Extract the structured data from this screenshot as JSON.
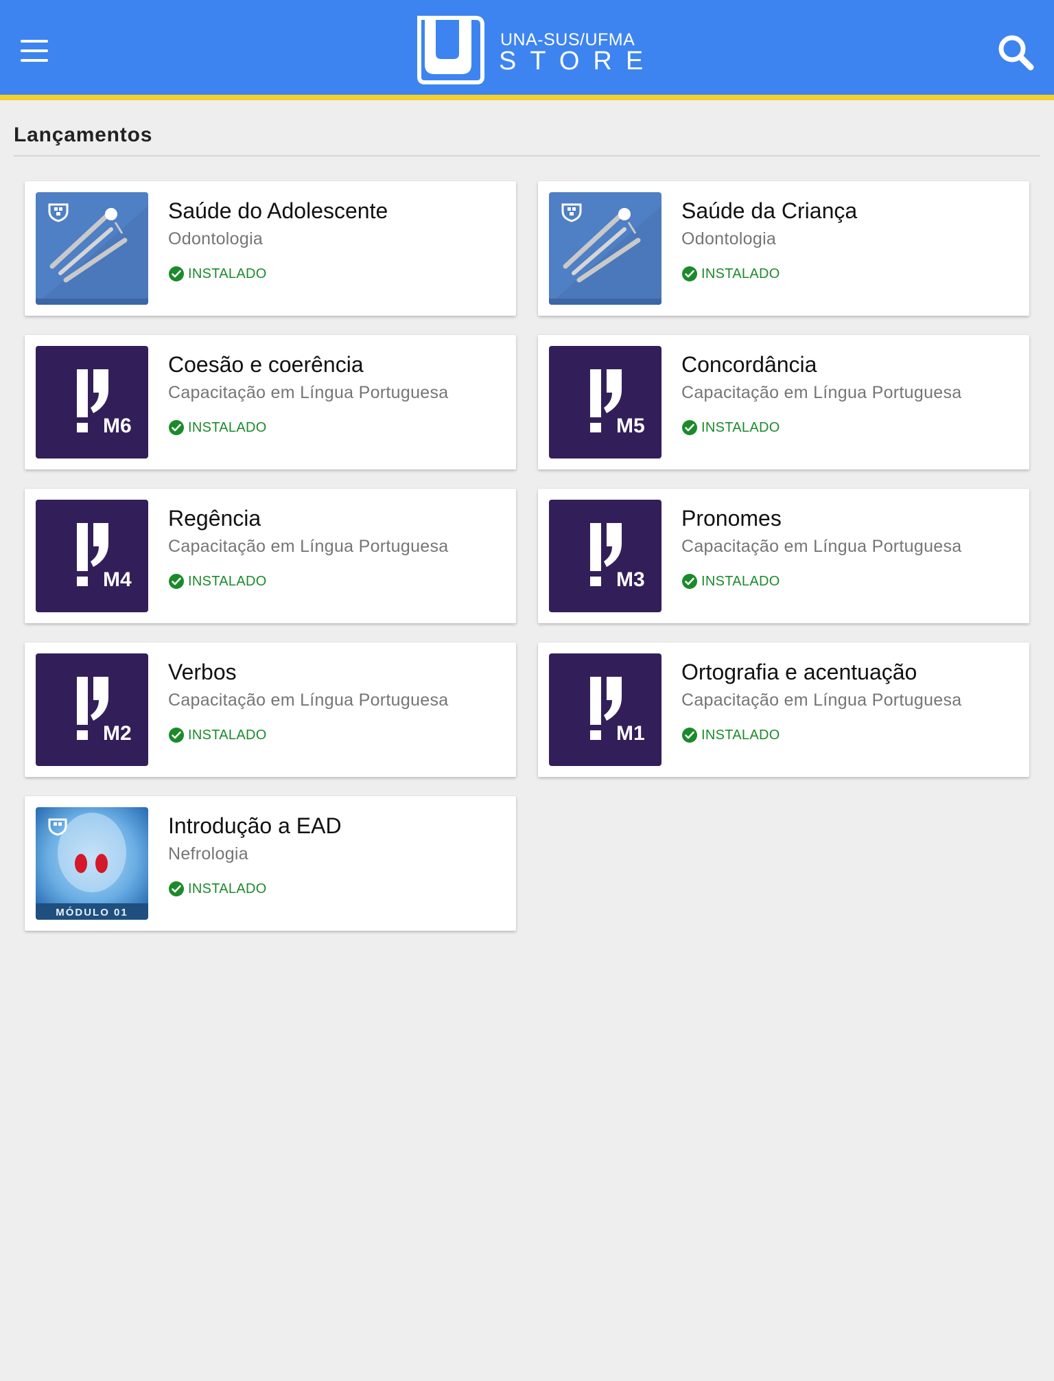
{
  "app_bar": {
    "logo_line1": "UNA-SUS/UFMA",
    "logo_line2": "STORE",
    "menu_icon": "hamburger-menu-icon",
    "search_icon": "search-icon",
    "colors": {
      "primary": "#3d84f0",
      "accent": "#f3d02e"
    }
  },
  "section": {
    "title": "Lançamentos"
  },
  "status_color": "#1b8a2a",
  "apps": [
    {
      "title": "Saúde do Adolescente",
      "subtitle": "Odontologia",
      "status": "INSTALADO",
      "icon": "dental-tools-icon"
    },
    {
      "title": "Saúde da Criança",
      "subtitle": "Odontologia",
      "status": "INSTALADO",
      "icon": "dental-tools-icon"
    },
    {
      "title": "Coesão e coerência",
      "subtitle": "Capacitação em Língua Portuguesa",
      "status": "INSTALADO",
      "icon": "module-icon",
      "module": "M6"
    },
    {
      "title": "Concordância",
      "subtitle": "Capacitação em Língua Portuguesa",
      "status": "INSTALADO",
      "icon": "module-icon",
      "module": "M5"
    },
    {
      "title": "Regência",
      "subtitle": "Capacitação em Língua Portuguesa",
      "status": "INSTALADO",
      "icon": "module-icon",
      "module": "M4"
    },
    {
      "title": "Pronomes",
      "subtitle": "Capacitação em Língua Portuguesa",
      "status": "INSTALADO",
      "icon": "module-icon",
      "module": "M3"
    },
    {
      "title": "Verbos",
      "subtitle": "Capacitação em Língua Portuguesa",
      "status": "INSTALADO",
      "icon": "module-icon",
      "module": "M2"
    },
    {
      "title": "Ortografia e acentuação",
      "subtitle": "Capacitação em Língua Portuguesa",
      "status": "INSTALADO",
      "icon": "module-icon",
      "module": "M1"
    },
    {
      "title": "Introdução a EAD",
      "subtitle": "Nefrologia",
      "status": "INSTALADO",
      "icon": "kidney-icon",
      "badge": "MÓDULO 01"
    }
  ]
}
